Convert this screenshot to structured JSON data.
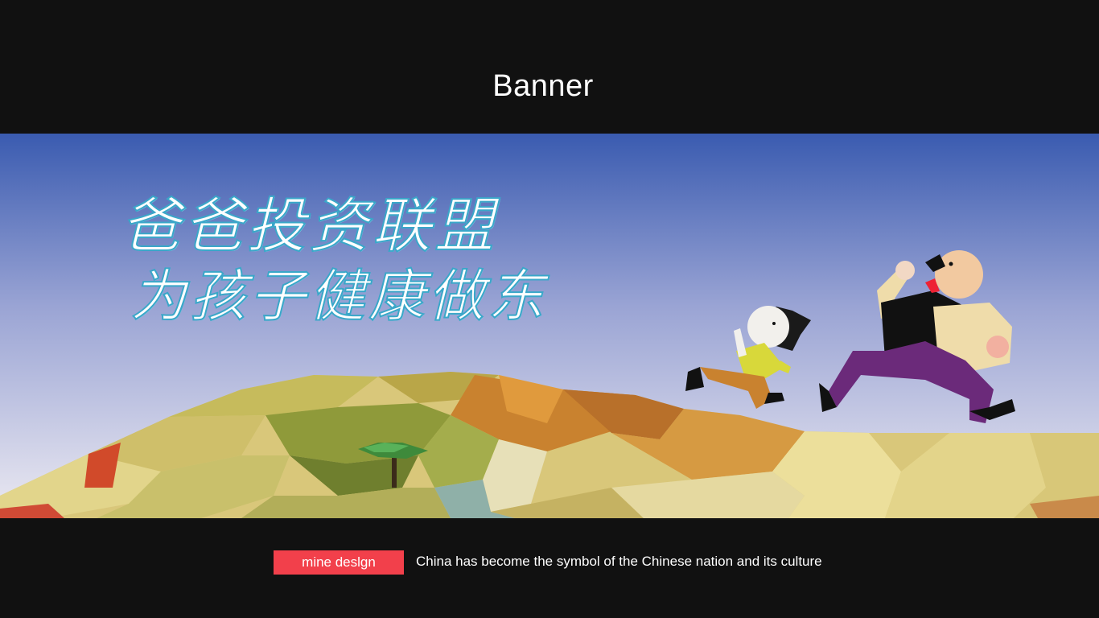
{
  "header": {
    "title": "Banner"
  },
  "banner": {
    "headline_line1": "爸爸投资联盟",
    "headline_line2": "为孩子健康做东"
  },
  "footer": {
    "tag_label": "mine deslgn",
    "caption": "China has become the symbol of the Chinese nation and its culture"
  },
  "colors": {
    "background": "#111111",
    "sky_top": "#3a5bb0",
    "sky_bottom": "#e6e7f2",
    "tag_red": "#f2404b",
    "headline_stroke": "#3aa7c9",
    "terrain_yellow": "#d9c77a",
    "terrain_orange": "#c9822f",
    "child_shirt": "#d8d83a",
    "dad_pants": "#6b2a7a"
  },
  "icons": [
    "tree-icon",
    "running-child-icon",
    "running-dad-icon"
  ]
}
